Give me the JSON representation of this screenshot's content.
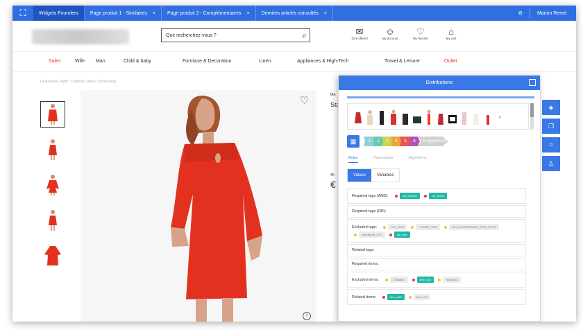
{
  "topbar": {
    "logo_icon": "expand-icon",
    "tabs": [
      {
        "label": "Widgets Founders"
      },
      {
        "label": "Page produit 1 - Similaires",
        "close": "×"
      },
      {
        "label": "Page produit 2 - Complémentaires",
        "close": "×"
      },
      {
        "label": "Derniers articles consultés",
        "close": "×"
      }
    ],
    "user": "Marion Renet"
  },
  "header": {
    "search_placeholder": "Que recherchez-vous ?",
    "icons": [
      {
        "icon": "mail-icon",
        "label": "10 € offerts!"
      },
      {
        "icon": "user-icon",
        "label": "My account"
      },
      {
        "icon": "heart-icon",
        "label": "My favorite"
      },
      {
        "icon": "bag-icon",
        "label": "My cart"
      }
    ]
  },
  "nav": [
    {
      "label": "Sales",
      "color": "#e4312b"
    },
    {
      "label": "Wife"
    },
    {
      "label": "Man"
    },
    {
      "label": "Child & baby"
    },
    {
      "label": "Furniture & Decoration"
    },
    {
      "label": "Linen"
    },
    {
      "label": "Appliances & High-Tech"
    },
    {
      "label": "Travel & Leisure"
    },
    {
      "label": "Outlet",
      "color": "#e4312b"
    }
  ],
  "breadcrumb": "La Redoute / Wife / Clothing / Dress / Short dress",
  "product_col": [
    "MA",
    "Sta",
    "",
    "",
    "",
    "",
    "",
    "40",
    "€",
    "",
    "",
    "",
    "",
    "",
    ""
  ],
  "panel": {
    "title": "Distributions",
    "steps": [
      "1",
      "2",
      "3",
      "4",
      "5",
      "6"
    ],
    "step_last": "Engagement",
    "step_colors": [
      "#8fd0d6",
      "#6cc6b6",
      "#c8d44a",
      "#f2a23a",
      "#e8584f",
      "#b54fb8"
    ],
    "subtabs": [
      "Rules",
      "Parameters",
      "Algorithms"
    ],
    "pill": [
      "Values",
      "Variables"
    ],
    "rows": [
      {
        "label": "Required tags (AND):",
        "tags": [
          {
            "text": "cat_dresses",
            "type": "green"
          },
          {
            "text": "cat_shoes",
            "type": "green"
          }
        ]
      },
      {
        "label": "Required tags (OR):",
        "tags": []
      },
      {
        "label": "Excluded tags:",
        "tags": [
          {
            "text": "CAT_NEW",
            "type": "grey"
          },
          {
            "text": "T-SHIRT_ONE",
            "type": "grey"
          },
          {
            "text": "CAT_ACCESSORIES_FOR_STYLE",
            "type": "grey"
          },
          {
            "text": "MAXIMUM_QTY",
            "type": "grey"
          },
          {
            "text": "cat_new",
            "type": "green"
          }
        ]
      },
      {
        "label": "Related tags:",
        "tags": []
      },
      {
        "label": "Required items:",
        "tags": []
      },
      {
        "label": "Excluded items:",
        "tags": [
          {
            "text": "72888810",
            "type": "grey"
          },
          {
            "text": "item_002",
            "type": "green"
          },
          {
            "text": "78543052",
            "type": "grey"
          }
        ]
      },
      {
        "label": "Related items:",
        "tags": [
          {
            "text": "item_003",
            "type": "green"
          },
          {
            "text": "item_004",
            "type": "grey"
          }
        ]
      }
    ]
  }
}
